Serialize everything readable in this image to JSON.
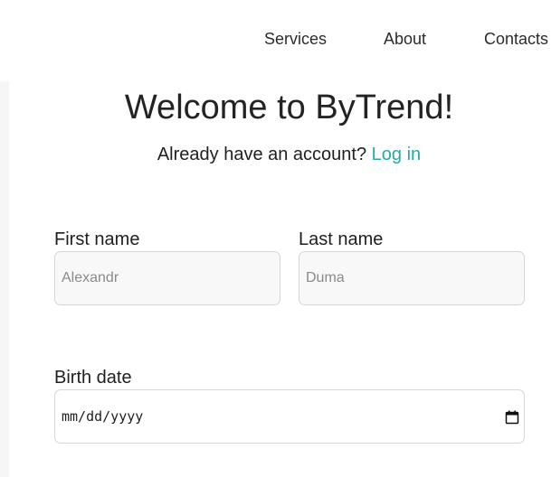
{
  "nav": {
    "items": [
      {
        "label": "Services"
      },
      {
        "label": "About"
      },
      {
        "label": "Contacts"
      }
    ]
  },
  "header": {
    "title": "Welcome to ByTrend!",
    "subtitle_text": "Already have an account?",
    "login_link": "Log in"
  },
  "form": {
    "first_name": {
      "label": "First name",
      "placeholder": "Alexandr"
    },
    "last_name": {
      "label": "Last name",
      "placeholder": "Duma"
    },
    "birth_date": {
      "label": "Birth date",
      "placeholder": "mm/dd/yyyy",
      "icon": "calendar-icon"
    }
  },
  "colors": {
    "accent": "#27a9a4",
    "top_border": "#57504a",
    "input_background": "#f8f8f8",
    "input_border": "#d6d6d6"
  }
}
